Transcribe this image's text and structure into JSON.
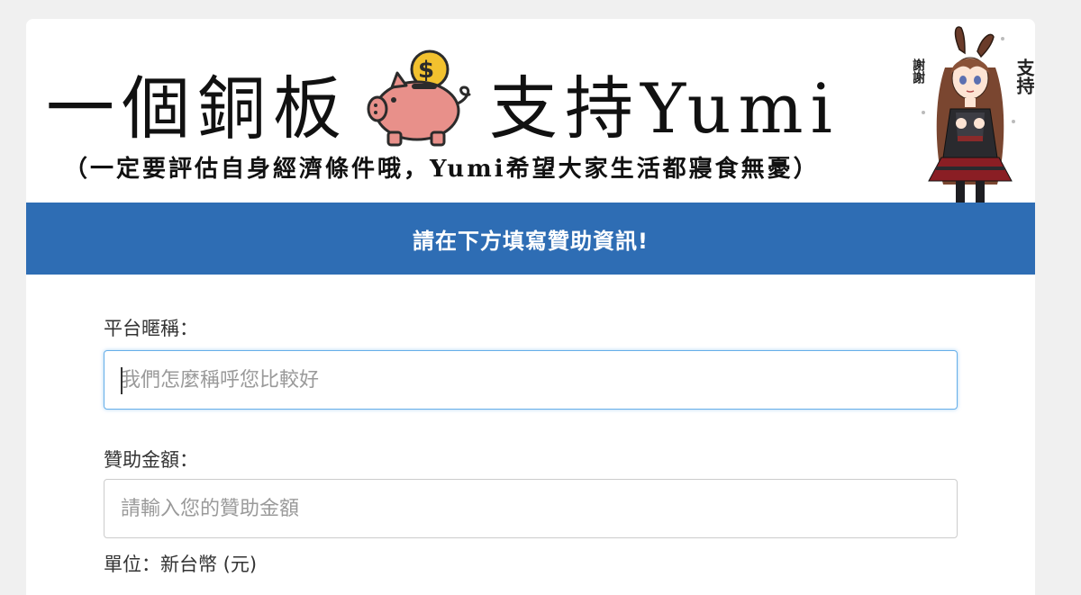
{
  "banner": {
    "title_part1": "一個銅板",
    "title_part2": "支持Yumi",
    "subtitle": "（一定要評估自身經濟條件哦，Yumi希望大家生活都寢食無憂）",
    "coin_symbol": "$",
    "character_bubble_thanks": "謝謝",
    "character_bubble_support": "支持",
    "icons": {
      "piggy_bank": "piggy-bank-icon",
      "coin": "dollar-coin-icon",
      "character": "anime-character-illustration"
    }
  },
  "form": {
    "heading": "請在下方填寫贊助資訊!",
    "nickname": {
      "label": "平台暱稱：",
      "placeholder": "我們怎麼稱呼您比較好",
      "value": ""
    },
    "amount": {
      "label": "贊助金額：",
      "placeholder": "請輸入您的贊助金額",
      "value": ""
    },
    "unit": "單位：新台幣 (元)"
  },
  "colors": {
    "heading_bar": "#2e6db4",
    "page_background": "#f0f0f0",
    "pig": "#e8908a",
    "coin": "#f2c12e",
    "focus_border": "#66afe9"
  }
}
